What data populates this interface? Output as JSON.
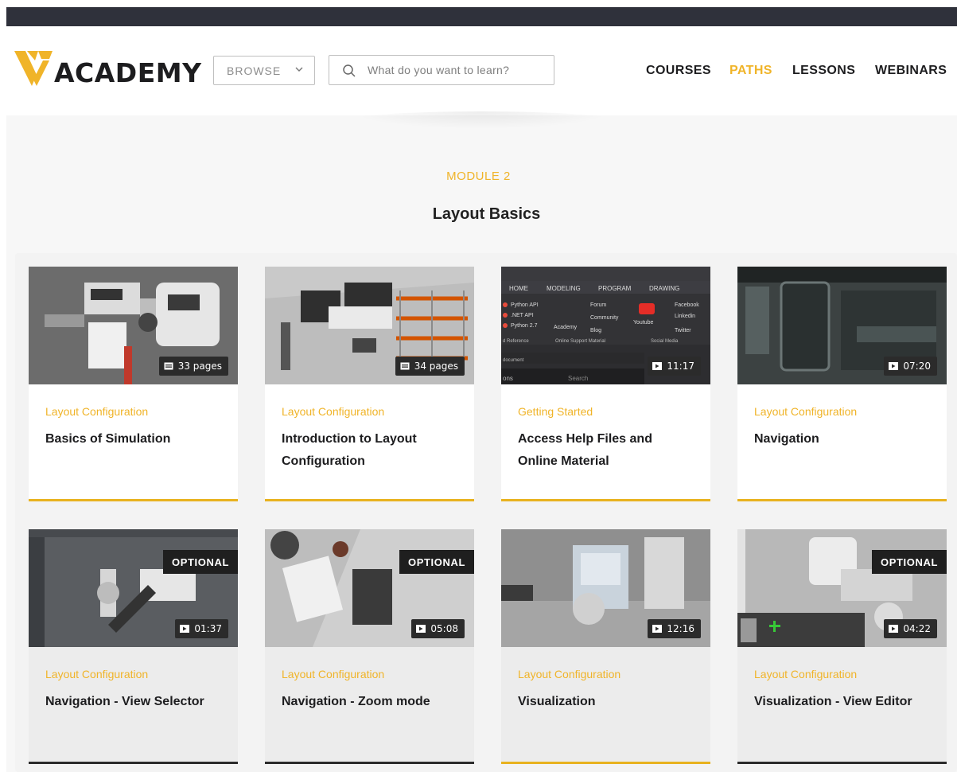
{
  "header": {
    "logo_text": "ACADEMY",
    "browse_label": "BROWSE",
    "search_placeholder": "What do you want to learn?",
    "nav": [
      {
        "label": "COURSES",
        "active": false
      },
      {
        "label": "PATHS",
        "active": true
      },
      {
        "label": "LESSONS",
        "active": false
      },
      {
        "label": "WEBINARS",
        "active": false
      }
    ]
  },
  "module": {
    "label": "MODULE 2",
    "title": "Layout Basics"
  },
  "cards": [
    {
      "category": "Layout Configuration",
      "title": "Basics of Simulation",
      "badge": "33 pages",
      "badge_icon": "pdf-icon",
      "optional": ""
    },
    {
      "category": "Layout Configuration",
      "title": "Introduction to Layout Configuration",
      "badge": "34 pages",
      "badge_icon": "pdf-icon",
      "optional": ""
    },
    {
      "category": "Getting Started",
      "title": "Access Help Files and Online Material",
      "badge": "11:17",
      "badge_icon": "video-icon",
      "optional": ""
    },
    {
      "category": "Layout Configuration",
      "title": "Navigation",
      "badge": "07:20",
      "badge_icon": "video-icon",
      "optional": ""
    },
    {
      "category": "Layout Configuration",
      "title": "Navigation - View Selector",
      "badge": "01:37",
      "badge_icon": "video-icon",
      "optional": "OPTIONAL"
    },
    {
      "category": "Layout Configuration",
      "title": "Navigation - Zoom mode",
      "badge": "05:08",
      "badge_icon": "video-icon",
      "optional": "OPTIONAL"
    },
    {
      "category": "Layout Configuration",
      "title": "Visualization",
      "badge": "12:16",
      "badge_icon": "video-icon",
      "optional": ""
    },
    {
      "category": "Layout Configuration",
      "title": "Visualization - View Editor",
      "badge": "04:22",
      "badge_icon": "video-icon",
      "optional": "OPTIONAL"
    }
  ],
  "thumb3_menu": {
    "tabs": [
      "HOME",
      "MODELING",
      "PROGRAM",
      "DRAWING"
    ],
    "items": [
      "Python API",
      ".NET API",
      "Python 2.7",
      "Forum",
      "Community",
      "Blog",
      "Academy",
      "Youtube",
      "Facebook",
      "Linkedin",
      "Twitter"
    ],
    "groups": [
      "d Reference",
      "Online Support Material",
      "Social Media"
    ],
    "doc_label": "document",
    "search_label": "Search",
    "tab_fragment": "ons"
  },
  "colors": {
    "accent": "#f0b429",
    "dark": "#2f313b",
    "badge_bg": "#2b2b2b"
  }
}
